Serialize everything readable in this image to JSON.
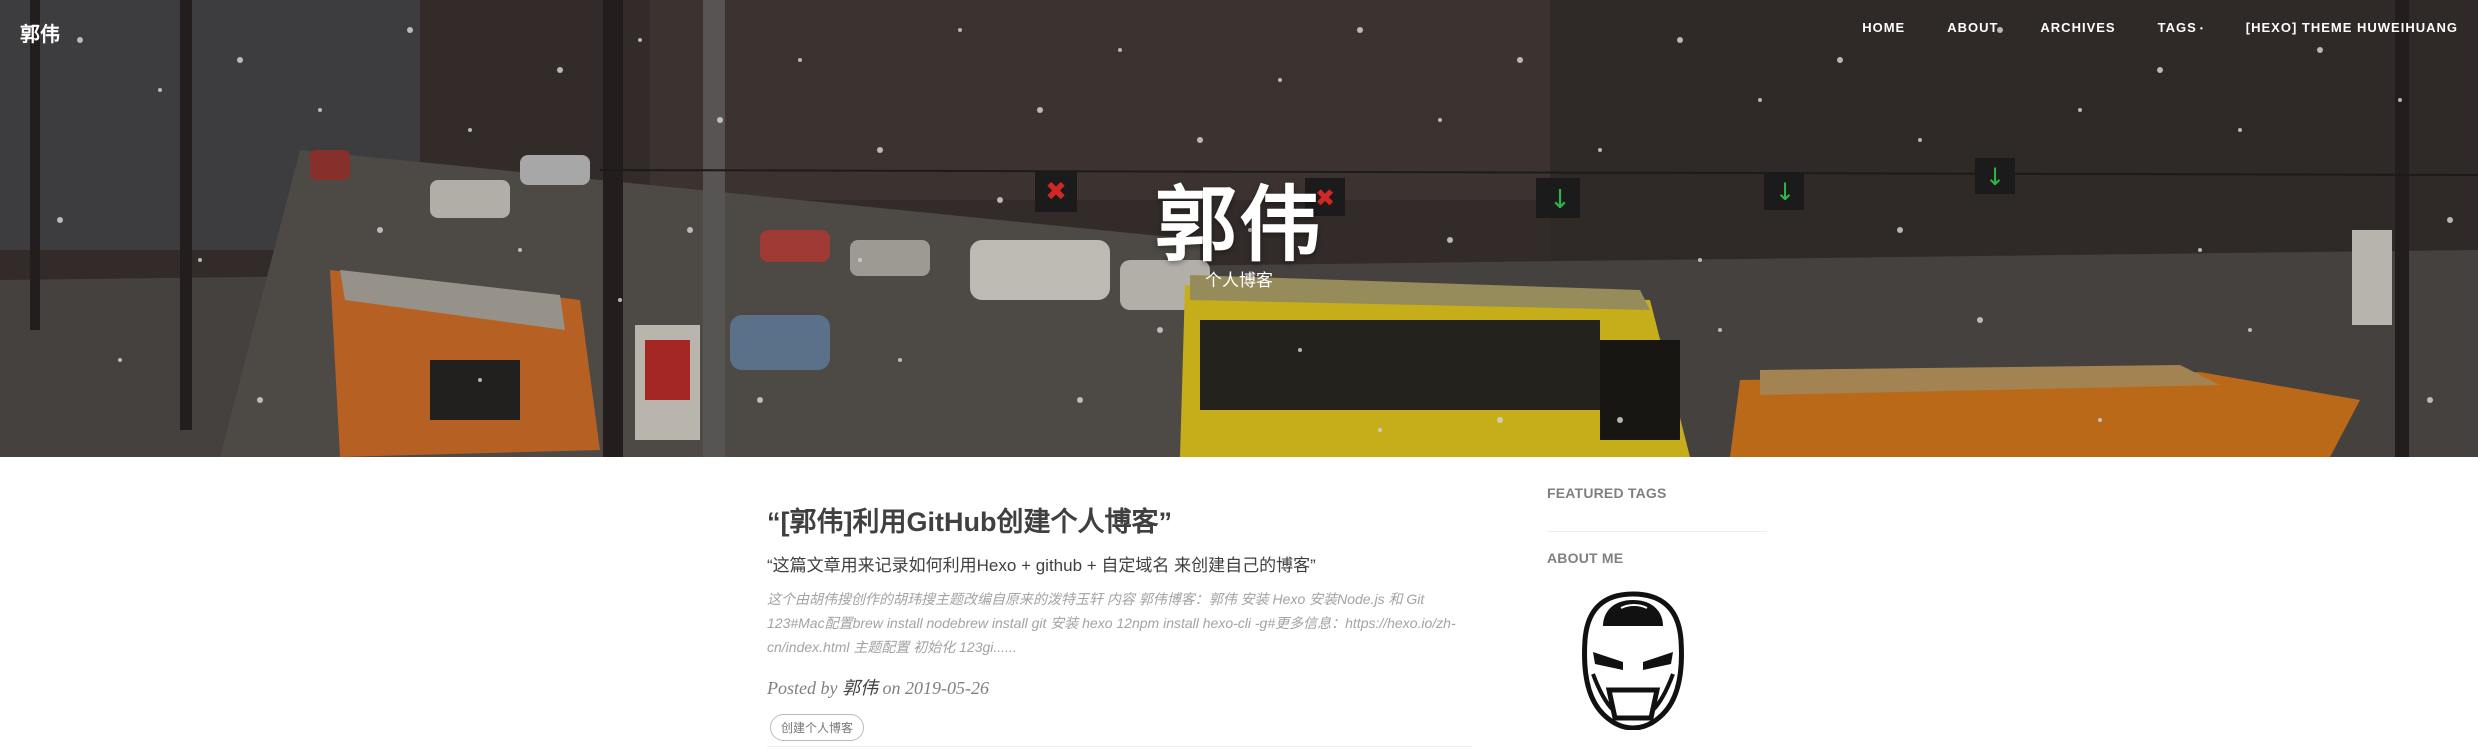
{
  "brand": "郭伟",
  "nav": {
    "items": [
      "Home",
      "About",
      "Archives",
      "Tags",
      "[Hexo] Theme HuweiHuang"
    ]
  },
  "hero": {
    "title": "郭伟",
    "subtitle": "个人博客"
  },
  "post": {
    "title": "“[郭伟]利用GitHub创建个人博客”",
    "subtitle": "“这篇文章用来记录如何利用Hexo + github + 自定域名 来创建自己的博客”",
    "excerpt": "这个由胡伟搜创作的胡玮搜主题改编自原来的泼特玉轩 内容 郭伟博客：郭伟 安装 Hexo 安装Node.js 和 Git 123#Mac配置brew install nodebrew install git 安装 hexo 12npm install hexo-cli -g#更多信息：https://hexo.io/zh-cn/index.html 主题配置 初始化 123gi......",
    "meta_prefix": "Posted by",
    "author": "郭伟",
    "meta_on": "on",
    "date": "2019-05-26",
    "tag": "创建个人博客"
  },
  "sidebar": {
    "featured_tags": "FEATURED TAGS",
    "about_me": "ABOUT ME"
  },
  "colors": {
    "text": "#404040",
    "muted": "#a3a3a3",
    "meta": "#808080"
  }
}
